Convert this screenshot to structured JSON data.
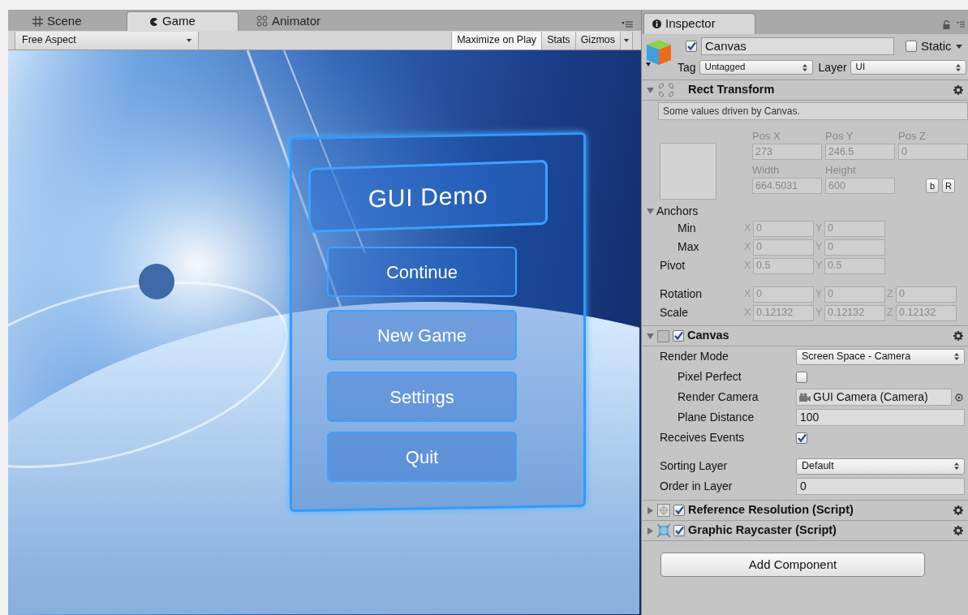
{
  "editor_tabs": [
    {
      "kind": "scene",
      "label": "Scene",
      "selected": false
    },
    {
      "kind": "game",
      "label": "Game",
      "selected": true
    },
    {
      "kind": "animator",
      "label": "Animator",
      "selected": false
    }
  ],
  "game_toolbar": {
    "aspect": "Free Aspect",
    "buttons": [
      {
        "label": "Maximize on Play",
        "on": true
      },
      {
        "label": "Stats",
        "on": false
      },
      {
        "label": "Gizmos",
        "on": false
      }
    ]
  },
  "game_menu": {
    "title": "GUI Demo",
    "buttons": [
      "Continue",
      "New Game",
      "Settings",
      "Quit"
    ]
  },
  "inspector": {
    "tab": "Inspector",
    "object": {
      "active": true,
      "name": "Canvas",
      "static_label": "Static",
      "static": false,
      "tag_label": "Tag",
      "tag": "Untagged",
      "layer_label": "Layer",
      "layer": "UI"
    },
    "components": [
      {
        "kind": "rect_transform",
        "title": "Rect Transform",
        "expanded": true,
        "note": "Some values driven by Canvas.",
        "pos_headers": [
          "Pos X",
          "Pos Y",
          "Pos Z"
        ],
        "pos_values": [
          "273",
          "246.5",
          "0"
        ],
        "size_headers": [
          "Width",
          "Height"
        ],
        "size_values": [
          "664.5031",
          "600"
        ],
        "mode_buttons": [
          "b",
          "R"
        ],
        "anchors": {
          "label": "Anchors",
          "expanded": true,
          "rows": [
            {
              "label": "Min",
              "fields": [
                {
                  "axis": "X",
                  "value": "0"
                },
                {
                  "axis": "Y",
                  "value": "0"
                }
              ]
            },
            {
              "label": "Max",
              "fields": [
                {
                  "axis": "X",
                  "value": "0"
                },
                {
                  "axis": "Y",
                  "value": "0"
                }
              ]
            }
          ]
        },
        "pivot": {
          "label": "Pivot",
          "fields": [
            {
              "axis": "X",
              "value": "0.5"
            },
            {
              "axis": "Y",
              "value": "0.5"
            }
          ]
        },
        "transform_rows": [
          {
            "label": "Rotation",
            "fields": [
              {
                "axis": "X",
                "value": "0"
              },
              {
                "axis": "Y",
                "value": "0"
              },
              {
                "axis": "Z",
                "value": "0"
              }
            ]
          },
          {
            "label": "Scale",
            "fields": [
              {
                "axis": "X",
                "value": "0.12132"
              },
              {
                "axis": "Y",
                "value": "0.12132"
              },
              {
                "axis": "Z",
                "value": "0.12132"
              }
            ]
          }
        ]
      },
      {
        "kind": "canvas",
        "title": "Canvas",
        "expanded": true,
        "enabled": true,
        "field_groups": [
          [
            {
              "kind": "dropdown",
              "label": "Render Mode",
              "value": "Screen Space - Camera",
              "children": [
                {
                  "kind": "checkbox",
                  "label": "Pixel Perfect",
                  "checked": false
                },
                {
                  "kind": "object",
                  "label": "Render Camera",
                  "value": "GUI Camera (Camera)"
                },
                {
                  "kind": "number",
                  "label": "Plane Distance",
                  "value": "100"
                }
              ]
            },
            {
              "kind": "checkbox",
              "label": "Receives Events",
              "checked": true
            }
          ],
          [
            {
              "kind": "dropdown",
              "label": "Sorting Layer",
              "value": "Default"
            },
            {
              "kind": "number",
              "label": "Order in Layer",
              "value": "0"
            }
          ]
        ]
      },
      {
        "kind": "script",
        "title": "Reference Resolution (Script)",
        "expanded": false,
        "enabled": true
      },
      {
        "kind": "raycaster",
        "title": "Graphic Raycaster (Script)",
        "expanded": false,
        "enabled": true
      }
    ],
    "add_button": "Add Component"
  }
}
